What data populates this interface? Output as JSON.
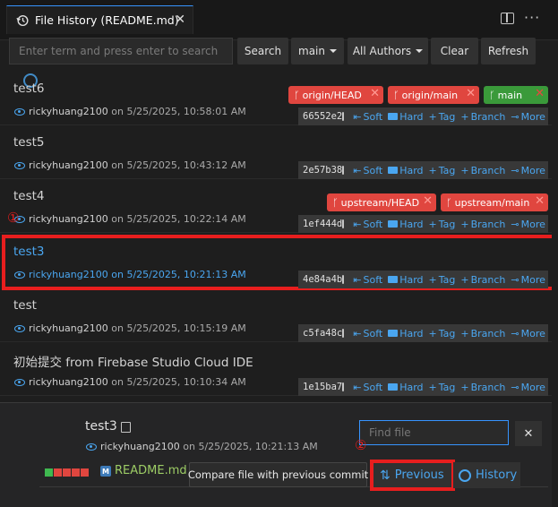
{
  "tab": {
    "title": "File History (README.md)",
    "close": "✕"
  },
  "toolbar": {
    "search_placeholder": "Enter term and press enter to search",
    "search_label": "Search",
    "branch_label": "main",
    "authors_label": "All Authors",
    "clear_label": "Clear",
    "refresh_label": "Refresh"
  },
  "actions": {
    "soft": "Soft",
    "hard": "Hard",
    "tag": "Tag",
    "branch": "Branch",
    "more": "More"
  },
  "commits": [
    {
      "title": "test6",
      "author": "rickyhuang2100",
      "date": "on 5/25/2025, 10:58:01 AM",
      "hash": "66552e2",
      "refs": [
        {
          "label": "origin/HEAD",
          "color": "red"
        },
        {
          "label": "origin/main",
          "color": "red"
        },
        {
          "label": "main",
          "color": "green"
        }
      ]
    },
    {
      "title": "test5",
      "author": "rickyhuang2100",
      "date": "on 5/25/2025, 10:43:12 AM",
      "hash": "2e57b38",
      "refs": []
    },
    {
      "title": "test4",
      "author": "rickyhuang2100",
      "date": "on 5/25/2025, 10:22:14 AM",
      "hash": "1ef444d",
      "refs": [
        {
          "label": "upstream/HEAD",
          "color": "red"
        },
        {
          "label": "upstream/main",
          "color": "red"
        }
      ]
    },
    {
      "title": "test3",
      "author": "rickyhuang2100",
      "date": "on 5/25/2025, 10:21:13 AM",
      "hash": "4e84a4b",
      "refs": []
    },
    {
      "title": "test",
      "author": "rickyhuang2100",
      "date": "on 5/25/2025, 10:15:19 AM",
      "hash": "c5fa48c",
      "refs": []
    },
    {
      "title": "初始提交 from Firebase Studio Cloud IDE",
      "author": "rickyhuang2100",
      "date": "on 5/25/2025, 10:10:34 AM",
      "hash": "1e15ba7",
      "refs": []
    }
  ],
  "markers": {
    "one": "①",
    "two": "②"
  },
  "details": {
    "title": "test3",
    "author": "rickyhuang2100",
    "date": "on 5/25/2025, 10:21:13 AM",
    "find_placeholder": "Find file",
    "find_clear": "✕",
    "file_name": "README.md",
    "file_icon": "M",
    "tooltip": "Compare file with previous commit",
    "previous_label": "Previous",
    "history_label": "History"
  },
  "colors": {
    "accent": "#3794ff",
    "link": "#4aa6f0",
    "highlight": "#e81e1e",
    "ref_red": "#e0463f",
    "ref_green": "#3a9a3a",
    "diff_green": "#3fb950",
    "diff_red": "#e0463f"
  },
  "diffstat": [
    "green",
    "red",
    "red",
    "red",
    "red"
  ]
}
